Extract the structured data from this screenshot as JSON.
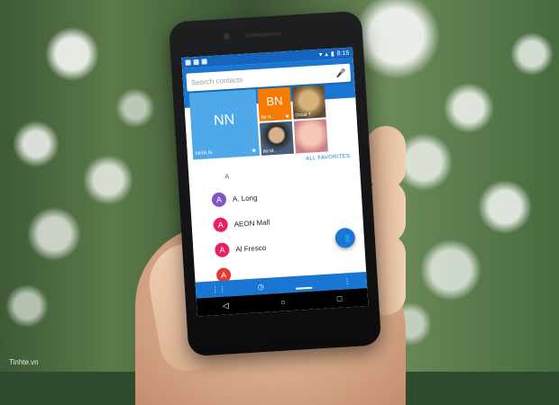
{
  "status_bar": {
    "time": "8:15"
  },
  "search": {
    "placeholder": "Search contacts"
  },
  "favorites": {
    "tiles": [
      {
        "initials": "NN",
        "name": "NHA N.",
        "color": "#4fa8e8"
      },
      {
        "initials": "BN",
        "name": "Bé N.",
        "color": "#f57c00"
      },
      {
        "name": "Oscar T."
      },
      {
        "name": "Bé M."
      },
      {
        "name": ""
      }
    ],
    "all_link": "ALL FAVORITES"
  },
  "contacts": {
    "section_letter": "A",
    "items": [
      {
        "initial": "A",
        "name": "A. Long",
        "color": "#7e57c2"
      },
      {
        "initial": "A",
        "name": "AEON Mall",
        "color": "#e91e63"
      },
      {
        "initial": "A",
        "name": "Al Fresco",
        "color": "#e91e63"
      },
      {
        "initial": "A",
        "name": "",
        "color": "#e53935"
      }
    ]
  },
  "bottom_tabs": {
    "active_icon": "contacts-icon"
  },
  "watermark": "Tinhte.vn",
  "accent": "#1976d2"
}
